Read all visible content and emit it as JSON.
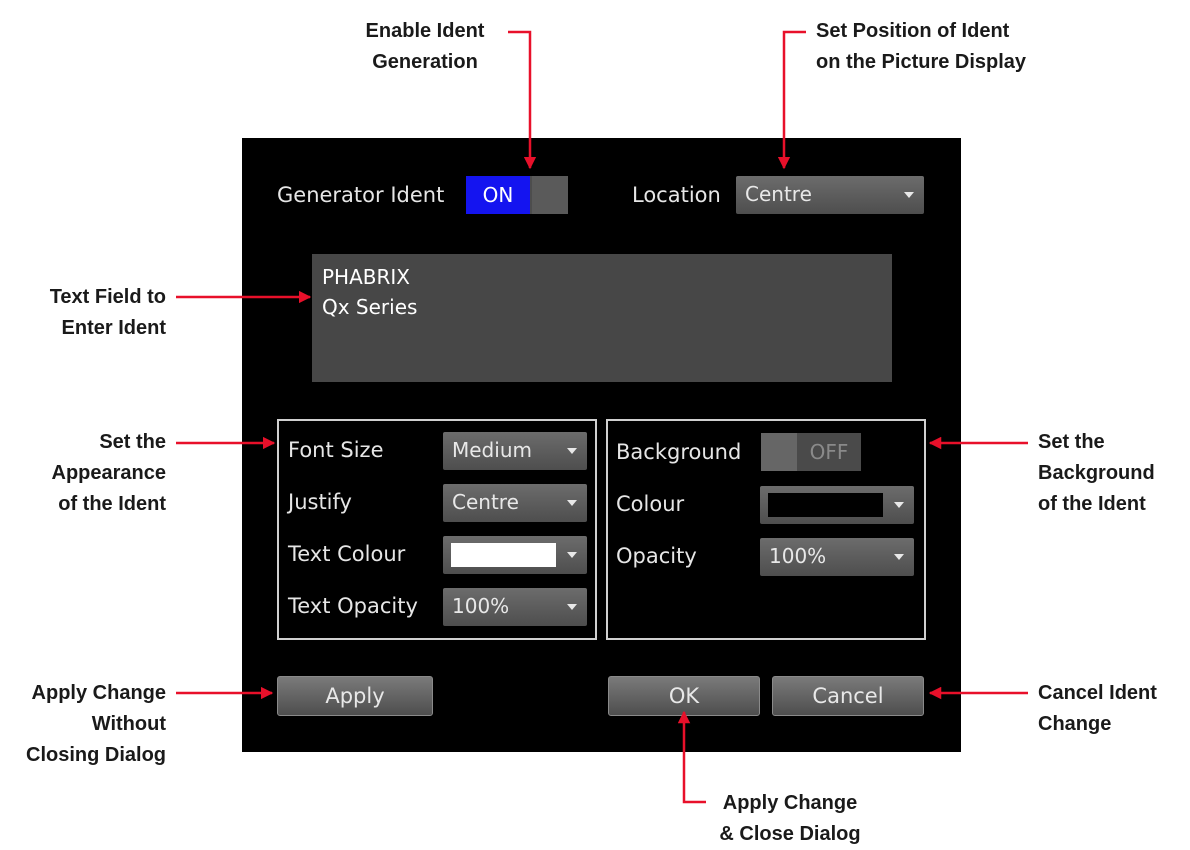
{
  "callouts": {
    "enable_ident": [
      "Enable Ident",
      "Generation"
    ],
    "set_position": [
      "Set Position of Ident",
      "on the Picture Display"
    ],
    "text_field": [
      "Text Field to",
      "Enter Ident"
    ],
    "appearance": [
      "Set the",
      "Appearance",
      "of the Ident"
    ],
    "background": [
      "Set the",
      "Background",
      "of the Ident"
    ],
    "apply": [
      "Apply Change",
      "Without",
      "Closing Dialog"
    ],
    "cancel": [
      "Cancel Ident",
      "Change"
    ],
    "ok": [
      "Apply Change",
      "& Close Dialog"
    ]
  },
  "dialog": {
    "generator_ident": {
      "label": "Generator Ident",
      "state": "ON"
    },
    "location": {
      "label": "Location",
      "value": "Centre"
    },
    "ident_text": [
      "PHABRIX",
      "Qx Series"
    ],
    "appearance": {
      "font_size": {
        "label": "Font Size",
        "value": "Medium"
      },
      "justify": {
        "label": "Justify",
        "value": "Centre"
      },
      "text_colour": {
        "label": "Text Colour",
        "color": "#ffffff"
      },
      "text_opacity": {
        "label": "Text Opacity",
        "value": "100%"
      }
    },
    "background": {
      "background": {
        "label": "Background",
        "state": "OFF"
      },
      "colour": {
        "label": "Colour",
        "color": "#000000"
      },
      "opacity": {
        "label": "Opacity",
        "value": "100%"
      }
    },
    "buttons": {
      "apply": "Apply",
      "ok": "OK",
      "cancel": "Cancel"
    }
  },
  "colors": {
    "arrow": "#e8102a",
    "dialog_bg": "#000000",
    "toggle_on": "#1414f0"
  }
}
